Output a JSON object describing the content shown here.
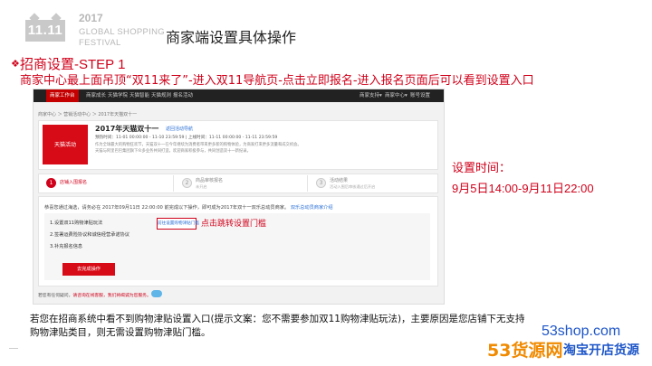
{
  "header": {
    "logo_text": "11.11",
    "year": "2017",
    "festival_line1": "GLOBAL SHOPPING",
    "festival_line2": "FESTIVAL",
    "title": "商家端设置具体操作"
  },
  "step": {
    "bullet": "❖",
    "title": "招商设置-STEP 1",
    "description": "商家中心最上面吊顶“双11来了”-进入双11导航页-点击立即报名-进入报名页面后可以看到设置入口"
  },
  "screenshot": {
    "nav_items": [
      "商家工作台",
      "商家成长",
      "天猫学院",
      "天猫智能",
      "天猫规则",
      "报名活动"
    ],
    "nav_right": [
      "商家支持▾",
      "商家中心▾",
      "账号设置"
    ],
    "breadcrumb": "商家中心 ＞ 营销活动中心 ＞ 2017年天猫双十一",
    "card_badge": "天猫活动",
    "card_title": "2017年天猫双十一",
    "card_link": "返回活动导航",
    "card_time": "预热时间：11-01 00:00:00 - 11-10 23:59:59  |  上线时间：11-11 00:00:00 - 11-11 23:59:59",
    "card_desc1": "作为全球最大的购物狂欢节，天猫双十一在今年继续为消费者带来更多新的购物体验，为商家打来更多流量和成交机会。",
    "card_desc2": "天猫与阿里巴巴集团旗下众多业务共同打造，欢迎商家积极参与，共同创造双十一新纪录。",
    "steps": [
      {
        "num": "1",
        "label": "店铺入围报名",
        "sub": ""
      },
      {
        "num": "2",
        "label": "商品审核报名",
        "sub": "未开启"
      },
      {
        "num": "3",
        "label": "活动结果",
        "sub": "活动入围后审核通过后开启"
      }
    ],
    "notice": "恭喜您通过海选，请务必在 2017年09月11日 22:00:00 前完成以下操作，即可成为2017年双十一双乐总动员商家。",
    "notice_link": "双乐总动员商家介绍",
    "items": [
      "1.设置双11购物津贴玩法",
      "2.签署运费险协议和诚信经营承诺协议",
      "3.补充报名信息"
    ],
    "threshold_button": "前往设置购物津贴门槛",
    "callout": "点击跳转设置门槛",
    "submit_button": "去完成操作",
    "footnote_prefix": "若您有任何疑问，",
    "footnote_warn": "请咨询在线客服，我们将竭诚为您服务。"
  },
  "timing": {
    "label": "设置时间：",
    "value": "9月5日14:00-9月11日22:00"
  },
  "note": {
    "line1": "若您在招商系统中看不到购物津贴设置入口(提示文案：您不需要参加双11购物津贴玩法)，主要原因是您店铺下无支持",
    "line2": "购物津贴类目，则无需设置购物津贴门槛。"
  },
  "watermark": {
    "url": "53shop.com",
    "brand": "53货源网",
    "sub": "淘宝开店货源"
  }
}
